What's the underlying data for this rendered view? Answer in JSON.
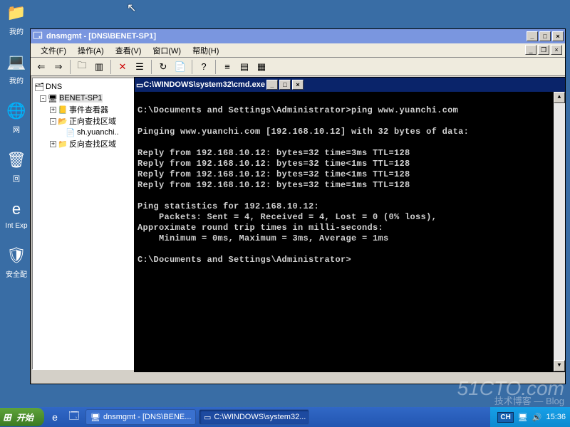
{
  "desktop": {
    "icons": [
      {
        "label": "我的",
        "glyph": "📁"
      },
      {
        "label": "我的",
        "glyph": "💻"
      },
      {
        "label": "网",
        "glyph": "🌐"
      },
      {
        "label": "回",
        "glyph": "🗑"
      },
      {
        "label": "Int Exp",
        "glyph": "🌐"
      },
      {
        "label": "安全配",
        "glyph": "🛡"
      }
    ]
  },
  "dns_window": {
    "title": "dnsmgmt - [DNS\\BENET-SP1]",
    "menus": [
      "文件(F)",
      "操作(A)",
      "查看(V)",
      "窗口(W)",
      "帮助(H)"
    ],
    "tree": {
      "root": "DNS",
      "server": "BENET-SP1",
      "nodes": [
        "事件查看器",
        "正向查找区域",
        "sh.yuanchi..",
        "反向查找区域"
      ]
    }
  },
  "cmd_window": {
    "title": "C:\\WINDOWS\\system32\\cmd.exe",
    "lines": [
      "",
      "C:\\Documents and Settings\\Administrator>ping www.yuanchi.com",
      "",
      "Pinging www.yuanchi.com [192.168.10.12] with 32 bytes of data:",
      "",
      "Reply from 192.168.10.12: bytes=32 time=3ms TTL=128",
      "Reply from 192.168.10.12: bytes=32 time<1ms TTL=128",
      "Reply from 192.168.10.12: bytes=32 time<1ms TTL=128",
      "Reply from 192.168.10.12: bytes=32 time=1ms TTL=128",
      "",
      "Ping statistics for 192.168.10.12:",
      "    Packets: Sent = 4, Received = 4, Lost = 0 (0% loss),",
      "Approximate round trip times in milli-seconds:",
      "    Minimum = 0ms, Maximum = 3ms, Average = 1ms",
      "",
      "C:\\Documents and Settings\\Administrator>"
    ]
  },
  "taskbar": {
    "start": "开始",
    "tasks": [
      {
        "label": "dnsmgmt - [DNS\\BENE...",
        "icon": "🖥"
      },
      {
        "label": "C:\\WINDOWS\\system32...",
        "icon": "▭"
      }
    ],
    "lang": "CH",
    "clock": "15:36"
  },
  "watermark": {
    "main": "51CTO.com",
    "sub": "技术博客 — Blog"
  }
}
